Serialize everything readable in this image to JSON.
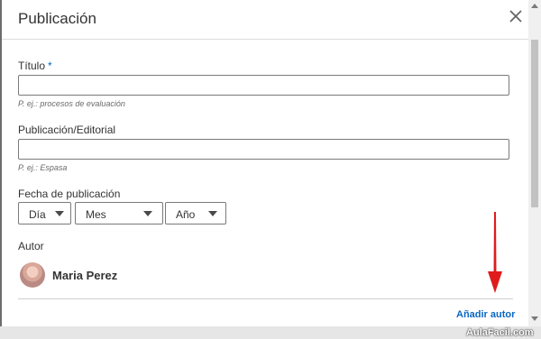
{
  "dialog": {
    "title": "Publicación",
    "close_icon": "close-icon"
  },
  "form": {
    "title_field": {
      "label": "Título",
      "required_mark": "*",
      "value": "",
      "hint": "P. ej.: procesos de evaluación"
    },
    "publisher_field": {
      "label": "Publicación/Editorial",
      "value": "",
      "hint": "P. ej.: Espasa"
    },
    "date": {
      "label": "Fecha de publicación",
      "day_select": "Día",
      "month_select": "Mes",
      "year_select": "Año"
    },
    "author": {
      "label": "Autor",
      "name": "Maria Perez",
      "add_link": "Añadir autor"
    }
  },
  "colors": {
    "accent": "#0a66c2",
    "annotation_arrow": "#e01b1b"
  },
  "watermark": "AulaFacil.com"
}
